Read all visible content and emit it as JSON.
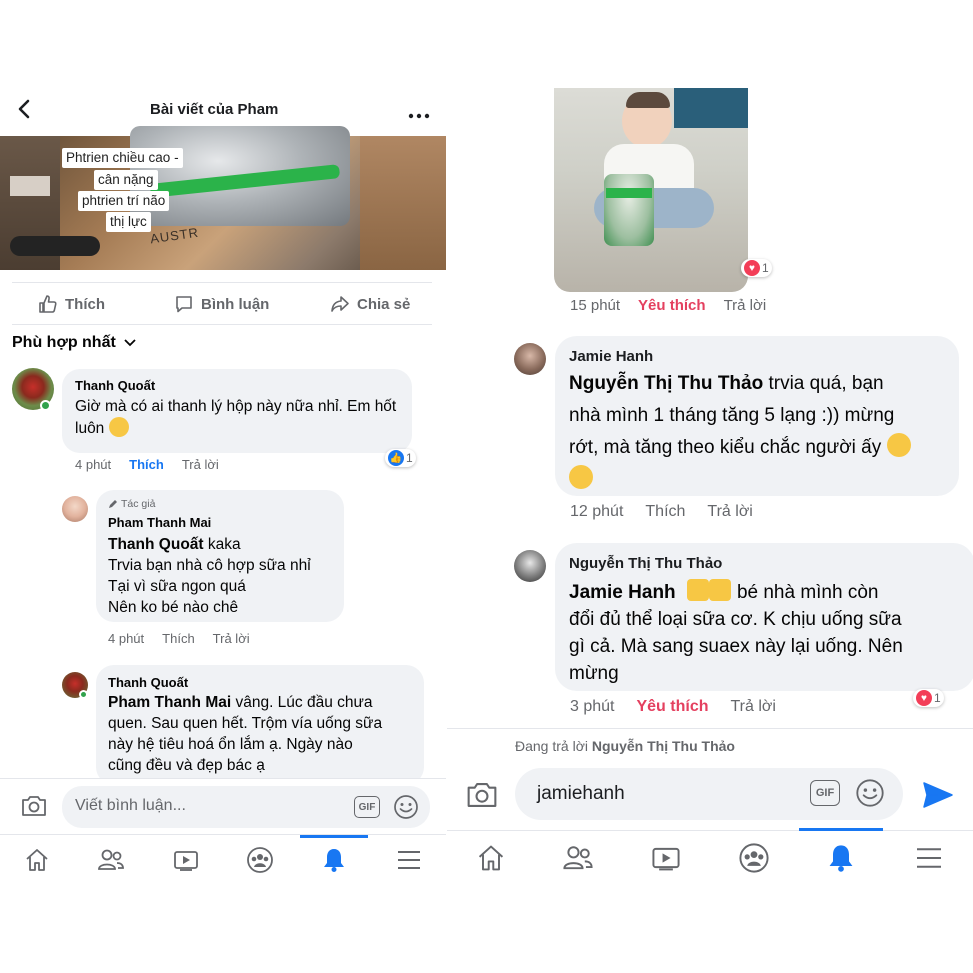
{
  "left": {
    "header": {
      "title": "Bài viết của Pham"
    },
    "photo_overlay": [
      "Phtrien chiều cao -",
      "cân nặng",
      "phtrien trí não",
      "thị lực"
    ],
    "photo_brand": "AUSTR",
    "actions": {
      "like": "Thích",
      "comment": "Bình luận",
      "share": "Chia sẻ"
    },
    "sort_label": "Phù hợp nhất",
    "comments": [
      {
        "name": "Thanh Quoất",
        "text": "Giờ mà có ai thanh lý hộp này nữa nhỉ. Em hốt luôn",
        "time": "4 phút",
        "like": "Thích",
        "reply": "Trả lời",
        "reaction_count": "1"
      },
      {
        "badge": "Tác giả",
        "name": "Pham Thanh Mai",
        "mention": "Thanh Quoất",
        "text_after_mention": " kaka",
        "lines": [
          "Trvia bạn nhà cô hợp sữa nhỉ",
          "Tại vì sữa ngon quá",
          "Nên ko bé nào chê"
        ],
        "time": "4 phút",
        "like": "Thích",
        "reply": "Trả lời"
      },
      {
        "name": "Thanh Quoất",
        "mention": "Pham Thanh Mai",
        "text_after_mention": "  vâng. Lúc đầu chưa",
        "lines": [
          "quen. Sau quen hết. Trộm vía uống sữa",
          "này hệ tiêu hoá ổn lắm ạ. Ngày nào",
          "cũng đều và đẹp bác ạ"
        ]
      }
    ],
    "input": {
      "placeholder": "Viết bình luận...",
      "gif": "GIF"
    }
  },
  "right": {
    "photo_reaction_count": "1",
    "photo_meta": {
      "time": "15 phút",
      "like": "Yêu thích",
      "reply": "Trả lời"
    },
    "comments": [
      {
        "name": "Jamie Hanh",
        "mention": "Nguyễn Thị Thu Thảo",
        "text_after_mention": " trvia quá, bạn",
        "lines": [
          "nhà mình 1 tháng tăng 5 lạng :)) mừng",
          "rớt, mà tăng theo kiểu chắc người ấy"
        ],
        "time": "12 phút",
        "like": "Thích",
        "reply": "Trả lời"
      },
      {
        "name": "Nguyễn Thị Thu Thảo",
        "mention": "Jamie Hanh",
        "text_after_mention": "bé nhà mình còn",
        "lines": [
          "đổi đủ thể loại sữa cơ. K chịu uống sữa",
          "gì cả. Mà sang suaex này lại uống. Nên",
          "mừng"
        ],
        "time": "3 phút",
        "like": "Yêu thích",
        "reply": "Trả lời",
        "reaction_count": "1"
      }
    ],
    "replying_prefix": "Đang trả lời ",
    "replying_to": "Nguyễn Thị Thu Thảo",
    "input": {
      "value": "jamiehanh",
      "gif": "GIF"
    }
  },
  "colors": {
    "facebook_blue": "#1877f2",
    "love_red": "#f33e58",
    "bubble_gray": "#f0f2f5",
    "meta_gray": "#65676b"
  }
}
